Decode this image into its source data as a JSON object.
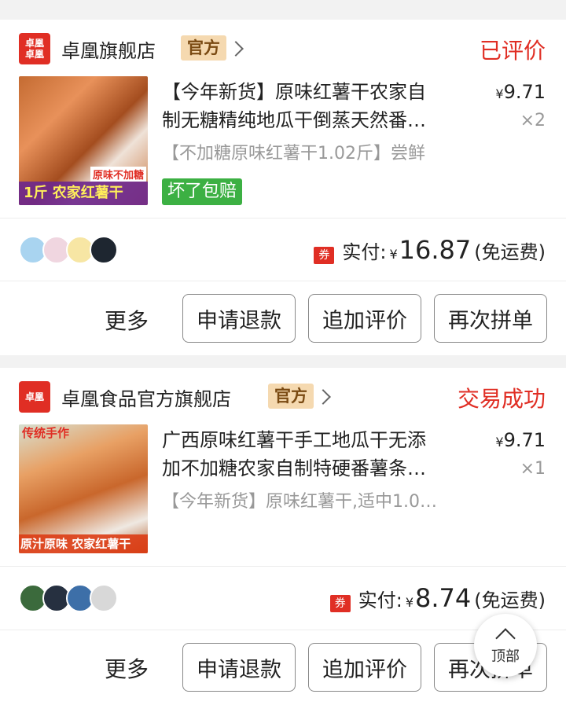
{
  "orders": [
    {
      "shop": {
        "logo_text": "卓凰\n卓凰",
        "name": "卓凰旗舰店",
        "official_tag": "官方"
      },
      "status": "已评价",
      "product": {
        "thumb_caption": "1斤 农家红薯干",
        "thumb_corner": "原味不加糖",
        "title_line1": "【今年新货】原味红薯干农家自",
        "title_line2": "制无糖精纯地瓜干倒蒸天然番…",
        "spec": "【不加糖原味红薯干1.02斤】尝鲜",
        "price_yen": "¥",
        "price": "9.71",
        "qty": "×2",
        "tag": "坏了包赔"
      },
      "paid": {
        "coupon": "券",
        "label": "实付:",
        "yen": "¥",
        "amount": "16.87",
        "note": "(免运费)"
      },
      "actions": {
        "more": "更多",
        "refund": "申请退款",
        "add_review": "追加评价",
        "reorder": "再次拼单"
      }
    },
    {
      "shop": {
        "logo_text": "卓凰",
        "name": "卓凰食品官方旗舰店",
        "official_tag": "官方"
      },
      "status": "交易成功",
      "product": {
        "thumb_top": "传统手作",
        "thumb_caption": "原汁原味 农家红薯干",
        "title_line1": "广西原味红薯干手工地瓜干无添",
        "title_line2": "加不加糖农家自制特硬番薯条…",
        "spec": "【今年新货】原味红薯干,适中1.0…",
        "price_yen": "¥",
        "price": "9.71",
        "qty": "×1"
      },
      "paid": {
        "coupon": "券",
        "label": "实付:",
        "yen": "¥",
        "amount": "8.74",
        "note": "(免运费)"
      },
      "actions": {
        "more": "更多",
        "refund": "申请退款",
        "add_review": "追加评价",
        "reorder": "再次拼单"
      }
    }
  ],
  "back_to_top": "顶部",
  "colors": {
    "accent": "#e02e24",
    "green_tag": "#3cb043",
    "official_tag_bg": "#f5d9b0"
  }
}
